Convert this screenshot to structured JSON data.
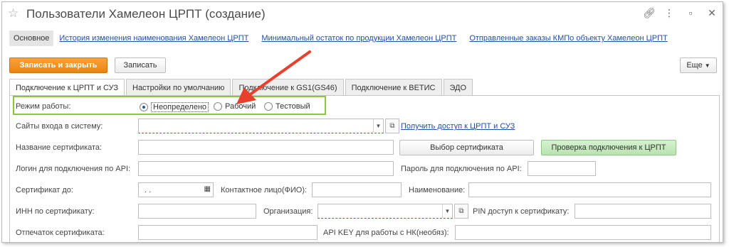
{
  "window": {
    "title": "Пользователи Хамелеон ЦРПТ (создание)"
  },
  "nav": {
    "active": "Основное",
    "links": [
      "История изменения наименования Хамелеон ЦРПТ",
      "Минимальный остаток по продукции Хамелеон ЦРПТ",
      "Отправленные заказы КМПо объекту Хамелеон ЦРПТ"
    ]
  },
  "toolbar": {
    "save_close": "Записать и закрыть",
    "save": "Записать",
    "more": "Еще"
  },
  "tabs": [
    "Подключение к ЦРПТ и СУЗ",
    "Настройки по умолчанию",
    "Подключение к GS1(GS46)",
    "Подключение к ВЕТИС",
    "ЭДО"
  ],
  "form": {
    "mode_label": "Режим работы:",
    "mode_options": [
      "Неопределено",
      "Рабочий",
      "Тестовый"
    ],
    "mode_selected": "Неопределено",
    "sites_label": "Сайты входа в систему:",
    "get_access_link": "Получить доступ к ЦРПТ и СУЗ",
    "cert_name_label": "Название сертификата:",
    "choose_cert_button": "Выбор сертификата",
    "check_conn_button": "Проверка подключения к ЦРПТ",
    "api_login_label": "Логин для подключения по API:",
    "api_password_label": "Пароль для подключения по API:",
    "cert_until_label": "Сертификат до:",
    "cert_until_value": " .  .",
    "contact_label": "Контактное лицо(ФИО):",
    "name_label": "Наименование:",
    "inn_label": "ИНН по сертификату:",
    "org_label": "Организация:",
    "pin_label": "PIN доступ к сертификату:",
    "thumbprint_label": "Отпечаток сертификата:",
    "api_key_label": "API KEY для работы с НК(необяз):"
  },
  "colors": {
    "primary_button": "#ea8410",
    "highlight_border": "#8cc63f",
    "annotation_arrow": "#e8402c",
    "link": "#1f4fa8"
  }
}
